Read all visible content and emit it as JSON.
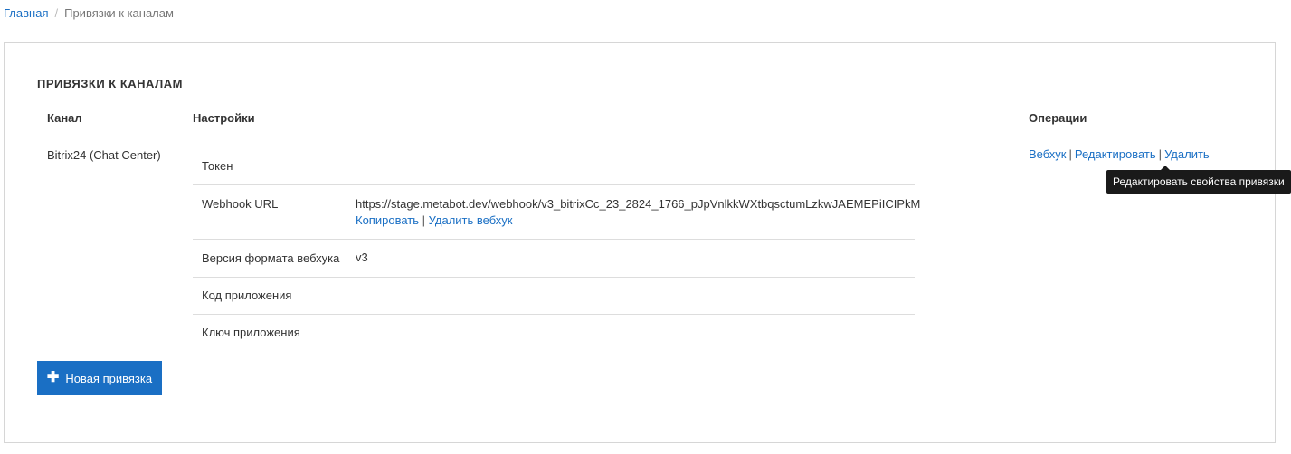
{
  "breadcrumb": {
    "home": "Главная",
    "current": "Привязки к каналам"
  },
  "section": {
    "title": "ПРИВЯЗКИ К КАНАЛАМ"
  },
  "table": {
    "headers": {
      "channel": "Канал",
      "settings": "Настройки",
      "operations": "Операции"
    },
    "row": {
      "channel": "Bitrix24 (Chat Center)",
      "settings": [
        {
          "label": "Токен",
          "value": ""
        },
        {
          "label": "Webhook URL",
          "value": "https://stage.metabot.dev/webhook/v3_bitrixCc_23_2824_1766_pJpVnlkkWXtbqsctumLzkwJAEMEPiICIPkM"
        },
        {
          "label": "Версия формата вебхука",
          "value": "v3"
        },
        {
          "label": "Код приложения",
          "value": ""
        },
        {
          "label": "Ключ приложения",
          "value": ""
        }
      ],
      "webhook_links": {
        "copy": "Копировать",
        "separator": "|",
        "delete": "Удалить вебхук"
      },
      "operations": {
        "webhook": "Вебхук",
        "edit": "Редактировать",
        "delete": "Удалить",
        "separator": "|"
      }
    }
  },
  "tooltip": {
    "text": "Редактировать свойства привязки"
  },
  "new_button": {
    "icon": "plus-icon",
    "label": "Новая привязка"
  },
  "colors": {
    "link": "#1a6fc4",
    "button": "#1a6fc4",
    "tooltip_bg": "#1a1a1a"
  }
}
